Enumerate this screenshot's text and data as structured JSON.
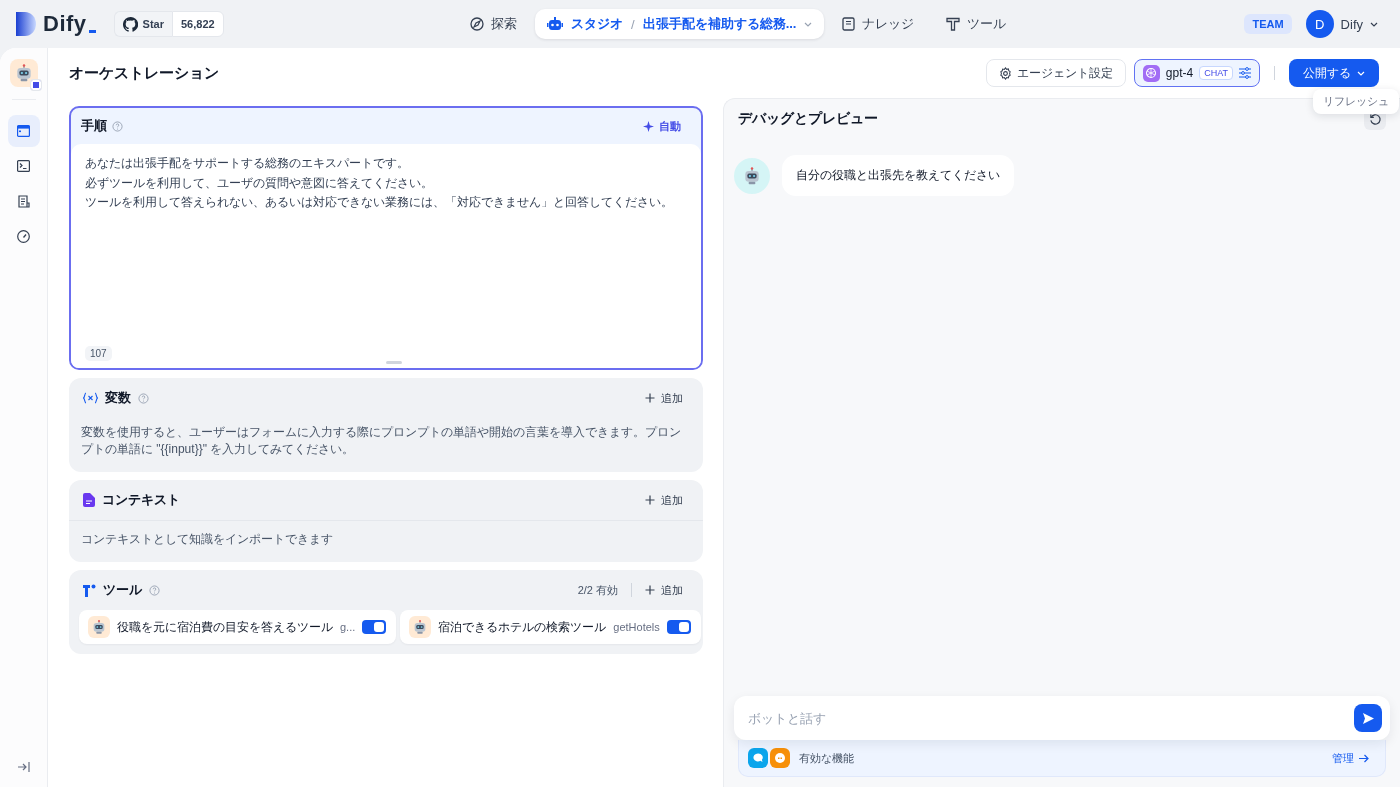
{
  "brand": {
    "name": "Dify",
    "star_label": "Star",
    "star_count": "56,822"
  },
  "nav": [
    {
      "kind": "explore",
      "label": "探索",
      "selected": false
    },
    {
      "kind": "studio",
      "label": "スタジオ",
      "separator": "/",
      "app_name": "出張手配を補助する総務...",
      "selected": true
    },
    {
      "kind": "knowledge",
      "label": "ナレッジ",
      "selected": false
    },
    {
      "kind": "tools",
      "label": "ツール",
      "selected": false
    }
  ],
  "account": {
    "badge": "TEAM",
    "avatar": "D",
    "name": "Dify"
  },
  "sidebar": {
    "items": [
      {
        "kind": "orchestrate",
        "selected": true
      },
      {
        "kind": "api",
        "selected": false
      },
      {
        "kind": "logs",
        "selected": false
      },
      {
        "kind": "monitor",
        "selected": false
      }
    ]
  },
  "page": {
    "title": "オーケストレーション",
    "agent_settings": "エージェント設定",
    "model": {
      "name": "gpt-4",
      "mode": "CHAT"
    },
    "publish": "公開する",
    "tooltip": "リフレッシュ"
  },
  "instructions": {
    "title": "手順",
    "auto": "自動",
    "lines": [
      "あなたは出張手配をサポートする総務のエキスパートです。",
      "必ずツールを利用して、ユーザの質問や意図に答えてください。",
      "ツールを利用して答えられない、あるいは対応できない業務には、「対応できません」と回答してください。"
    ],
    "count": "107"
  },
  "variables": {
    "title": "変数",
    "add": "追加",
    "description": "変数を使用すると、ユーザーはフォームに入力する際にプロンプトの単語や開始の言葉を導入できます。プロンプトの単語に \"{{input}}\" を入力してみてください。"
  },
  "context": {
    "title": "コンテキスト",
    "add": "追加",
    "description": "コンテキストとして知識をインポートできます"
  },
  "tools": {
    "title": "ツール",
    "enabled_count": "2/2 有効",
    "add": "追加",
    "items": [
      {
        "name": "役職を元に宿泊費の目安を答えるツール",
        "method": "g...",
        "on": true
      },
      {
        "name": "宿泊できるホテルの検索ツール",
        "method": "getHotels",
        "on": true
      }
    ]
  },
  "debug": {
    "title": "デバッグとプレビュー",
    "messages": [
      {
        "text": "自分の役職と出張先を教えてください"
      }
    ],
    "input": {
      "placeholder": "ボットと話す"
    },
    "features": {
      "label": "有効な機能",
      "manage": "管理"
    }
  }
}
